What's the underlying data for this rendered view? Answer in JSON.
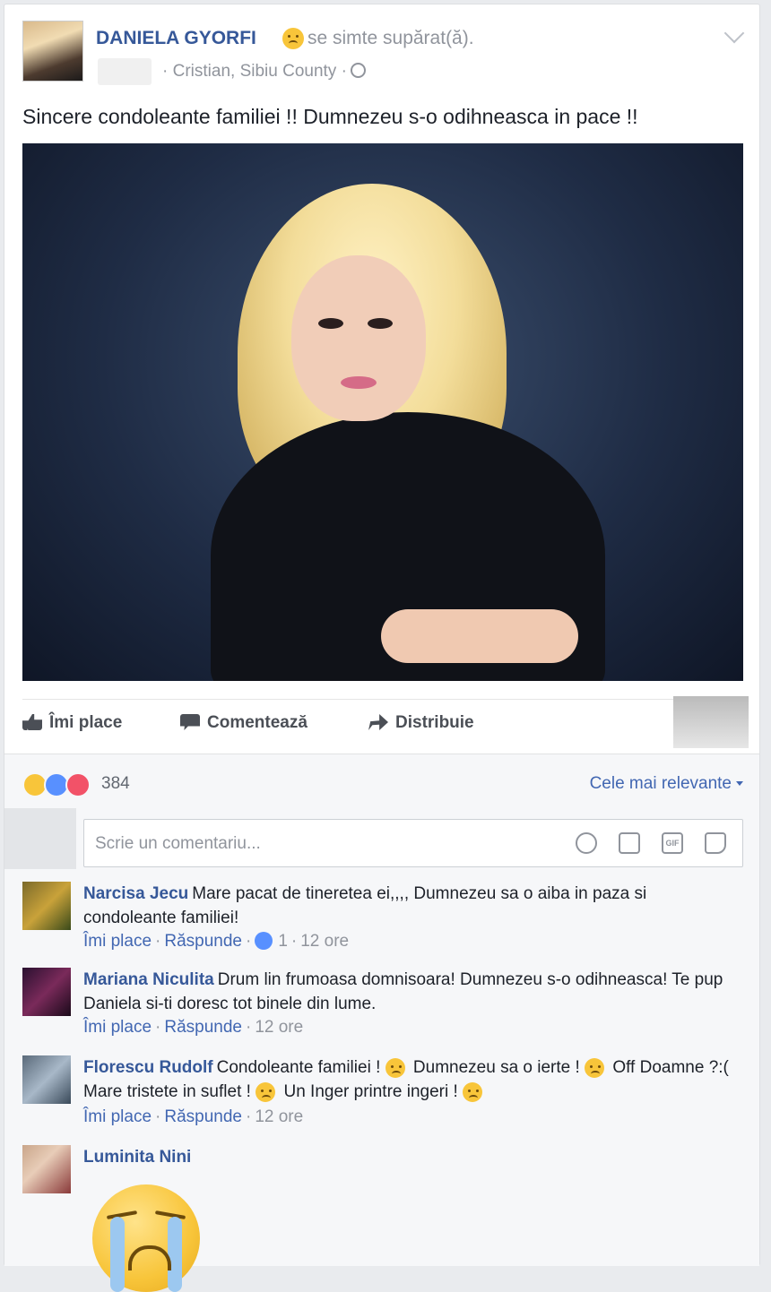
{
  "post": {
    "author": "DANIELA GYORFI",
    "feeling": "se simte supărat(ă).",
    "location": "· Cristian, Sibiu County ·",
    "text": "Sincere condoleante familiei !! Dumnezeu s-o odihneasca in pace !!"
  },
  "actions": {
    "like": "Îmi place",
    "comment": "Comentează",
    "share": "Distribuie"
  },
  "reactions": {
    "icons": [
      "sad-icon",
      "like-icon",
      "love-icon"
    ],
    "count": "384",
    "sort_label": "Cele mai relevante"
  },
  "composer": {
    "placeholder": "Scrie un comentariu..."
  },
  "comments": [
    {
      "name": "Narcisa Jecu",
      "text": "Mare pacat de tineretea ei,,,, Dumnezeu sa o aiba in paza si condoleante familiei!",
      "like": "Îmi place",
      "reply": "Răspunde",
      "like_count": "1",
      "time": "12 ore"
    },
    {
      "name": "Mariana Niculita",
      "text": "Drum lin frumoasa domnisoara! Dumnezeu s-o odihneasca! Te pup Daniela si-ti doresc tot binele din lume.",
      "like": "Îmi place",
      "reply": "Răspunde",
      "time": "12 ore"
    },
    {
      "name": "Florescu Rudolf",
      "text_1": "Condoleante familiei !",
      "text_2": "Dumnezeu sa o ierte !",
      "text_3": "Off Doamne ?:( Mare tristete in suflet !",
      "text_4": "Un Inger printre ingeri !",
      "like": "Îmi place",
      "reply": "Răspunde",
      "time": "12 ore"
    },
    {
      "name": "Luminita Nini"
    }
  ],
  "colors": {
    "link": "#365899",
    "accent": "#4267b2",
    "muted": "#90949c"
  }
}
